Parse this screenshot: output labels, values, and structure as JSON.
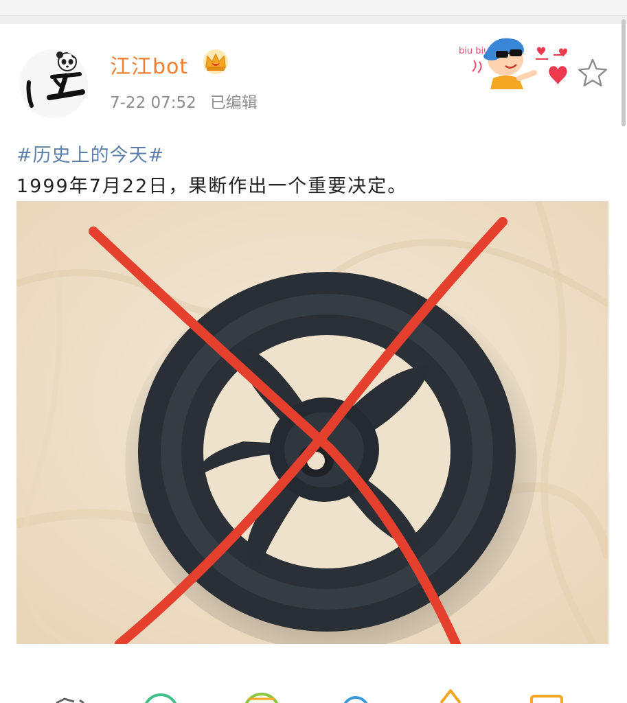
{
  "post": {
    "username": "江江bot",
    "time": "7-22 07:52",
    "edited_label": "已编辑",
    "hashtag": "#历史上的今天#",
    "text": "1999年7月22日，果断作出一个重要决定。",
    "sticker_text": "biu biu"
  },
  "icons": {
    "crown": "crown-vip-icon",
    "star": "star-outline-icon",
    "actions": [
      "share-icon",
      "smile-icon",
      "ball-icon",
      "bulb-icon",
      "tree-icon",
      "comment-icon"
    ]
  },
  "colors": {
    "username": "#f27d2e",
    "hashtag": "#5b7fa8",
    "meta": "#8c8c8c",
    "cross": "#e5402e",
    "action_green": "#3fbf8a",
    "action_blue": "#3a9bdc",
    "action_orange": "#f5a623"
  }
}
